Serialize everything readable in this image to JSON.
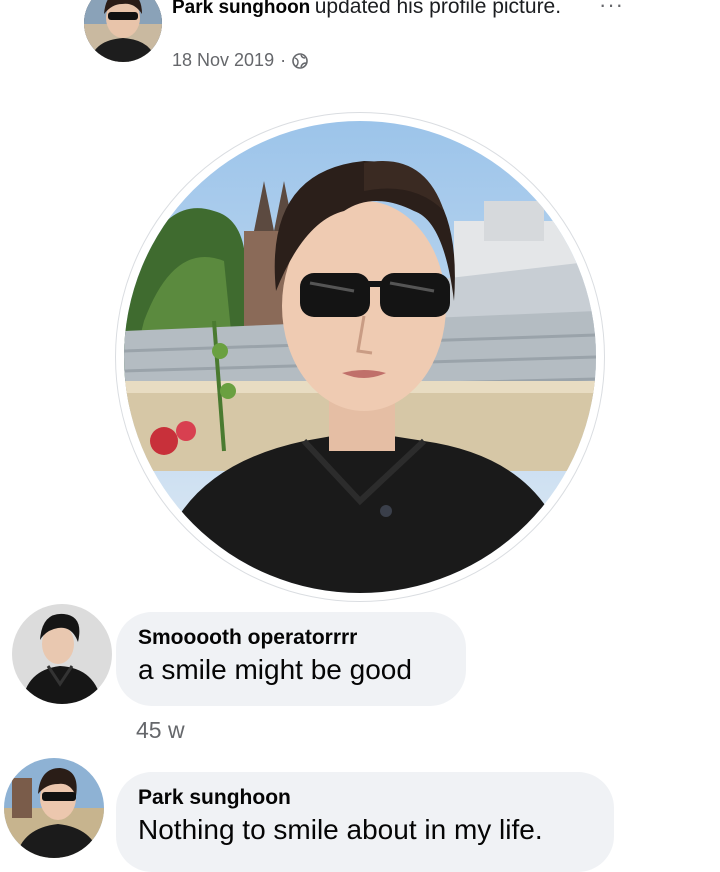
{
  "post": {
    "author": "Park sunghoon",
    "action": "updated his profile picture.",
    "date": "18 Nov 2019",
    "separator": "·",
    "audience_icon": "globe-icon",
    "more_icon": "more-options-icon"
  },
  "comments": [
    {
      "author": "Smooooth operatorrrr",
      "text": "a smile might be good",
      "time": "45 w"
    },
    {
      "author": "Park sunghoon",
      "text": "Nothing to smile about in my life."
    }
  ],
  "colors": {
    "bubble": "#f0f2f5",
    "secondary_text": "#65676b",
    "primary_text": "#050505"
  }
}
